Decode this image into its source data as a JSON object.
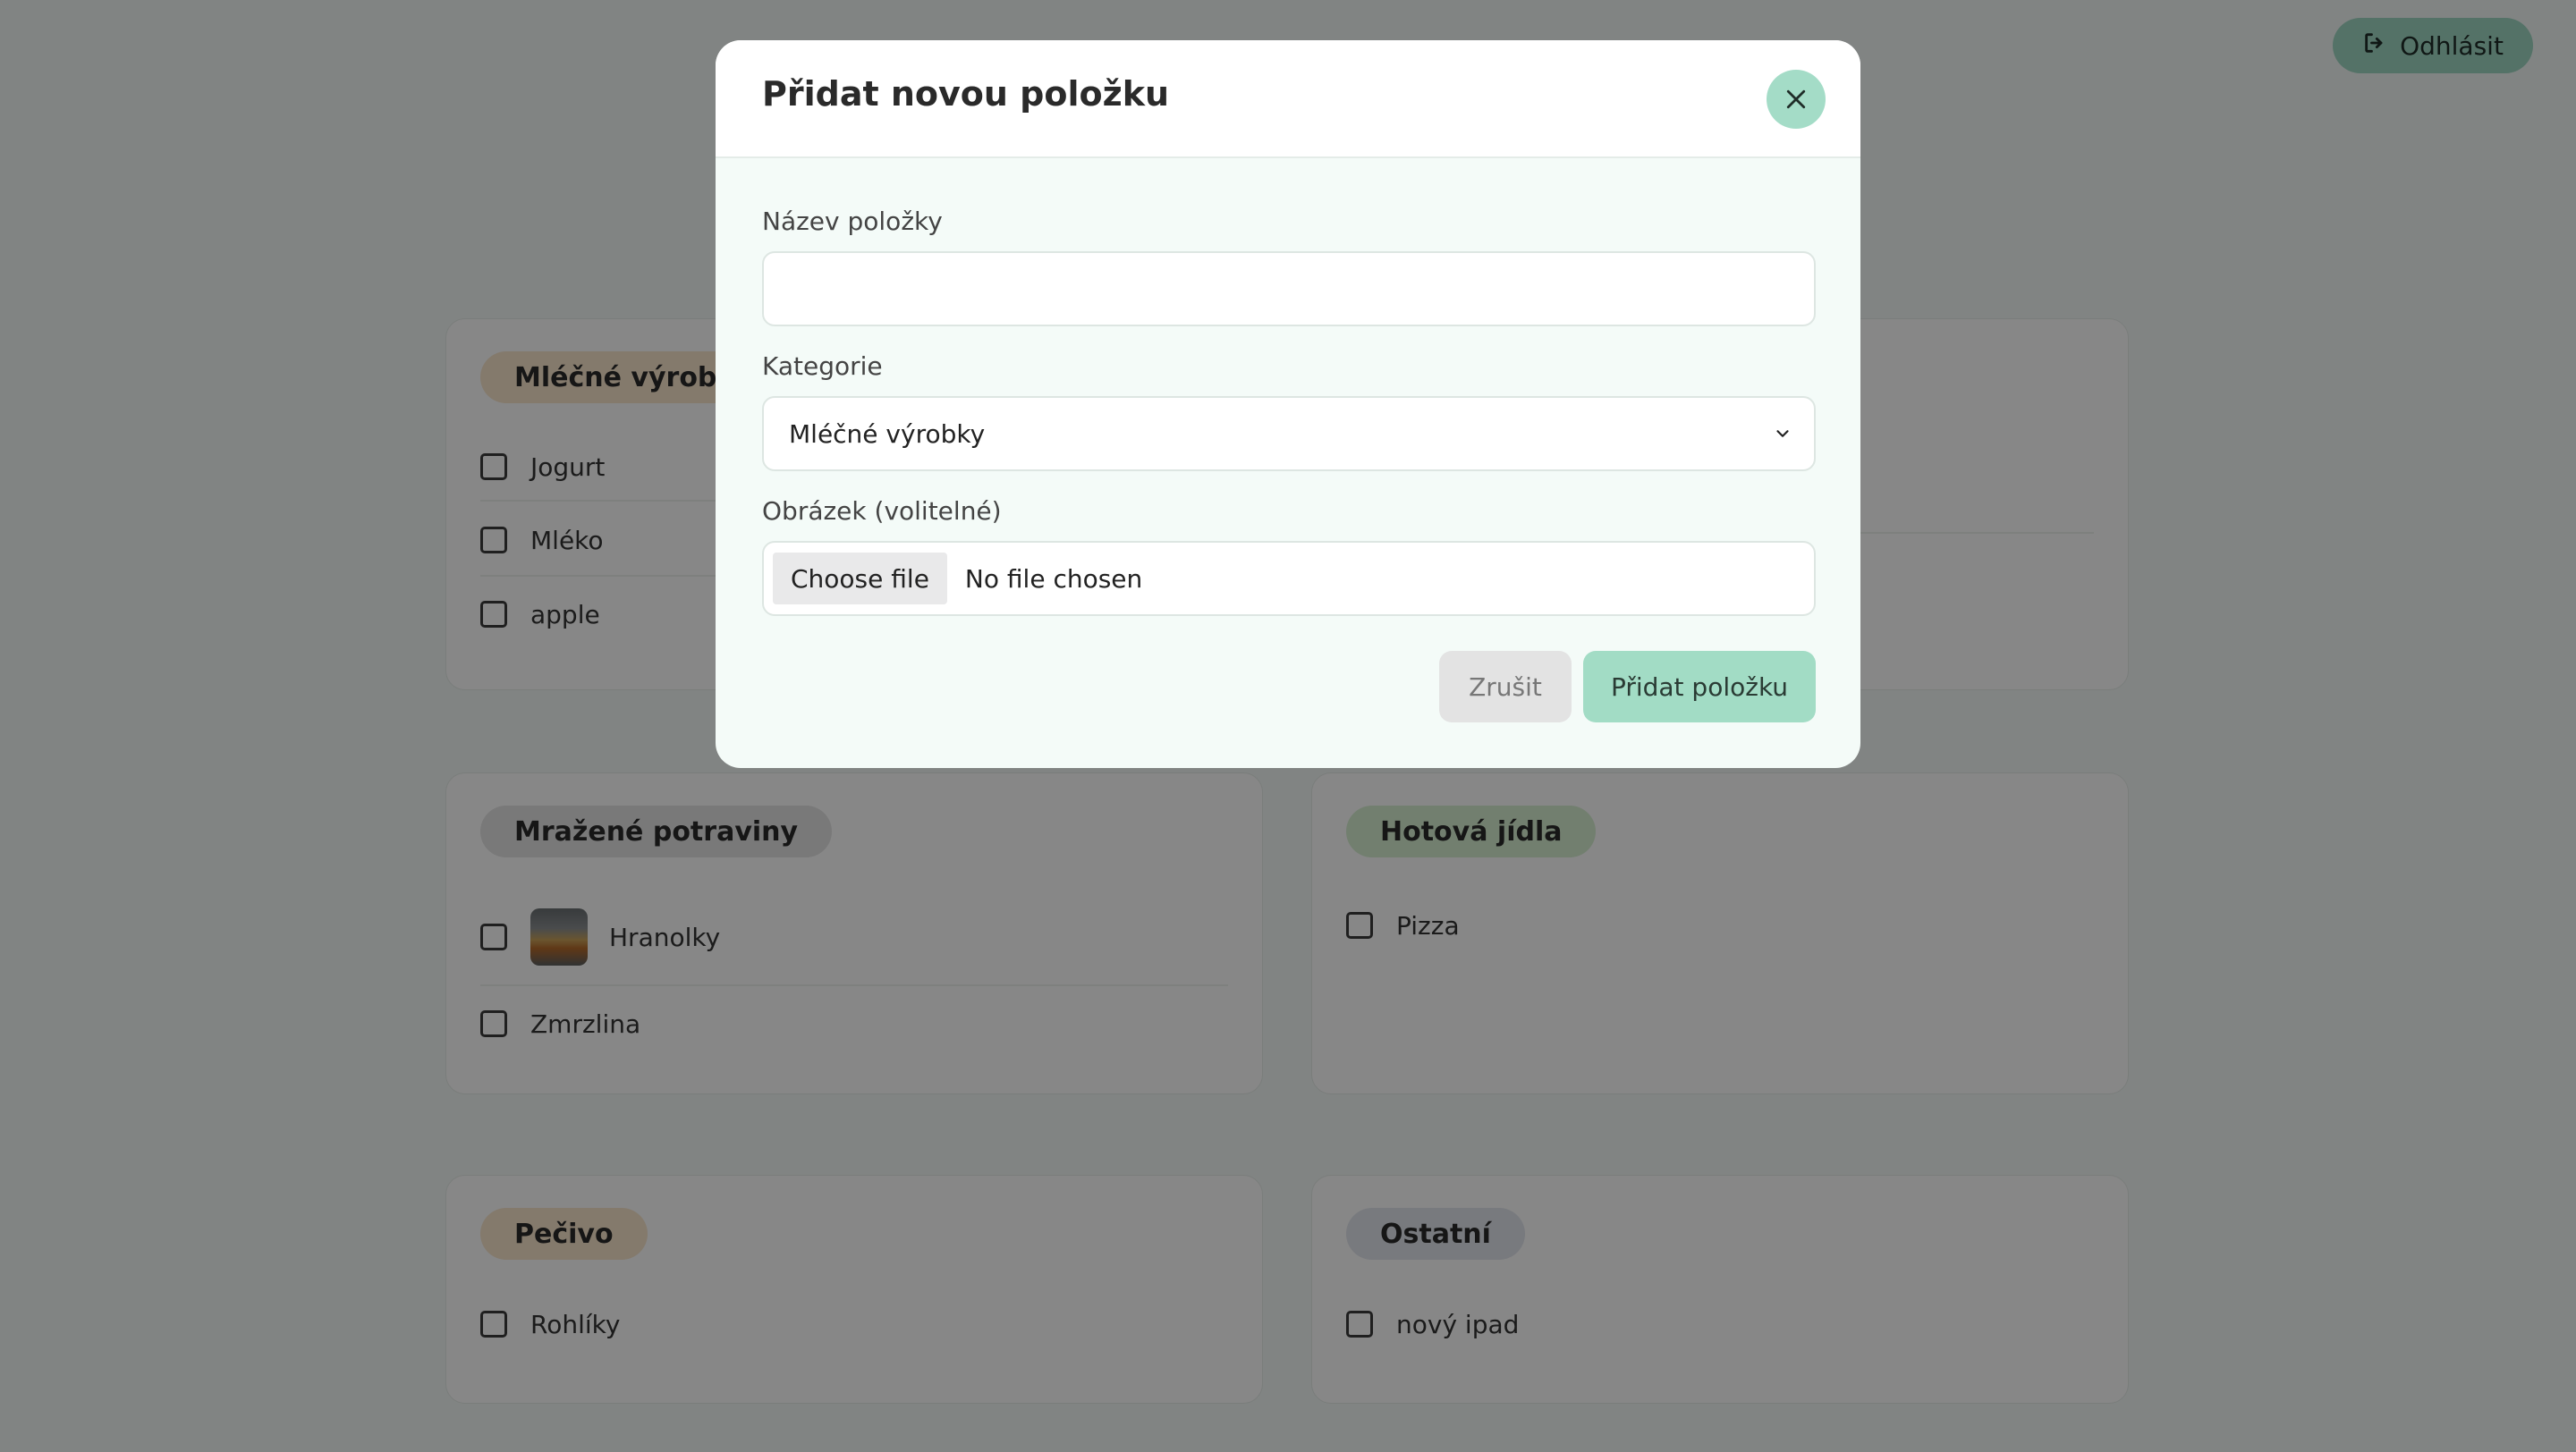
{
  "header": {
    "logout_label": "Odhlásit"
  },
  "categories": {
    "dairy": {
      "label": "Mléčné výrobky",
      "items": [
        "Jogurt",
        "Mléko",
        "apple"
      ]
    },
    "frozen": {
      "label": "Mražené potraviny",
      "items": [
        "Hranolky",
        "Zmrzlina"
      ]
    },
    "ready": {
      "label": "Hotová jídla",
      "items": [
        "Pizza"
      ]
    },
    "bakery": {
      "label": "Pečivo",
      "items": [
        "Rohlíky"
      ]
    },
    "other": {
      "label": "Ostatní",
      "items": [
        "nový ipad"
      ]
    }
  },
  "modal": {
    "title": "Přidat novou položku",
    "name_label": "Název položky",
    "name_value": "",
    "category_label": "Kategorie",
    "category_value": "Mléčné výrobky",
    "image_label": "Obrázek (volitelné)",
    "file_button": "Choose file",
    "file_status": "No file chosen",
    "cancel_label": "Zrušit",
    "submit_label": "Přidat položku"
  },
  "colors": {
    "accent": "#a2dcc5",
    "overlay": "rgba(0,0,0,0.47)",
    "dairy_pill": "#f9e6cc",
    "frozen_pill": "#e4e4e4",
    "ready_pill": "#d8f0d2",
    "other_pill": "#e3e6ee"
  },
  "icons": {
    "logout": "logout-icon",
    "close": "close-icon",
    "select": "chevron-down-icon"
  }
}
